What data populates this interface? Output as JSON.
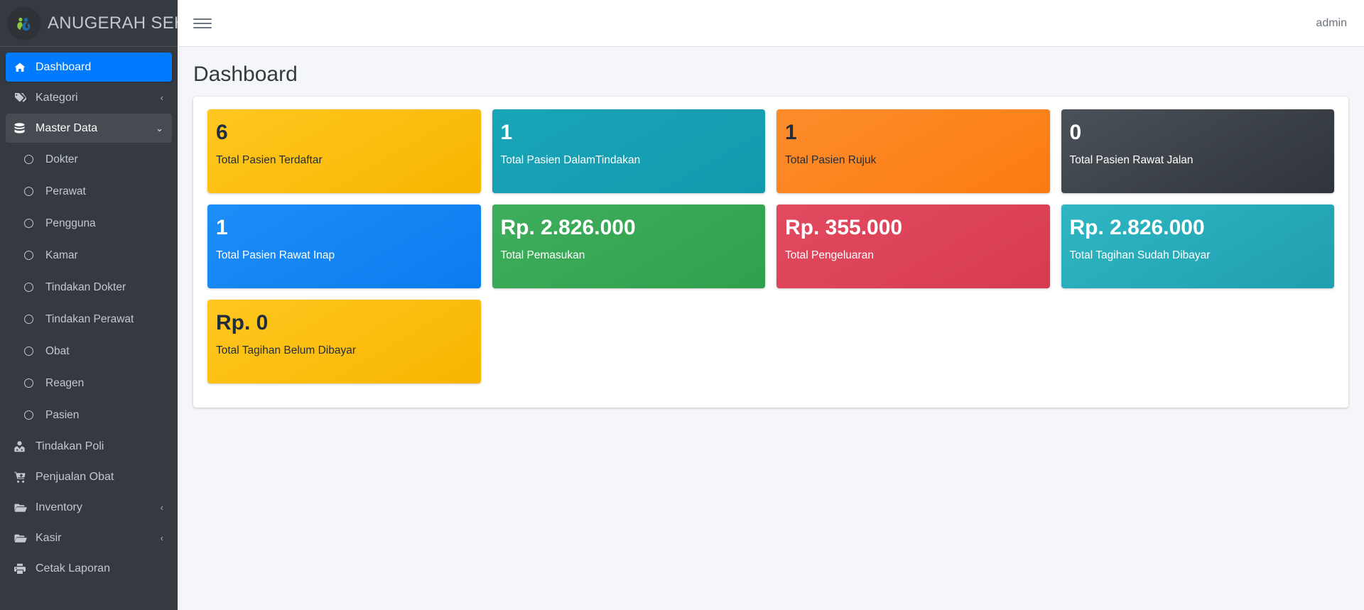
{
  "brand": {
    "title": "ANUGERAH SEHAT",
    "logo_icon": "anugerah-sehat-logo"
  },
  "topbar": {
    "menu_toggle_icon": "hamburger-icon",
    "user_label": "admin"
  },
  "page": {
    "title": "Dashboard"
  },
  "sidebar": {
    "items": [
      {
        "label": "Dashboard",
        "icon": "home-icon",
        "state": "active",
        "arrow": ""
      },
      {
        "label": "Kategori",
        "icon": "tag-icon",
        "state": "collapsed",
        "arrow": "‹"
      },
      {
        "label": "Master Data",
        "icon": "database-icon",
        "state": "open",
        "arrow": "⌄"
      }
    ],
    "master_data_children": [
      {
        "label": "Dokter",
        "icon": "circle-icon"
      },
      {
        "label": "Perawat",
        "icon": "circle-icon"
      },
      {
        "label": "Pengguna",
        "icon": "circle-icon"
      },
      {
        "label": "Kamar",
        "icon": "circle-icon"
      },
      {
        "label": "Tindakan Dokter",
        "icon": "circle-icon"
      },
      {
        "label": "Tindakan Perawat",
        "icon": "circle-icon"
      },
      {
        "label": "Obat",
        "icon": "circle-icon"
      },
      {
        "label": "Reagen",
        "icon": "circle-icon"
      },
      {
        "label": "Pasien",
        "icon": "circle-icon"
      }
    ],
    "items_bottom": [
      {
        "label": "Tindakan Poli",
        "icon": "user-md-icon",
        "state": "normal",
        "arrow": ""
      },
      {
        "label": "Penjualan Obat",
        "icon": "cart-plus-icon",
        "state": "normal",
        "arrow": ""
      },
      {
        "label": "Inventory",
        "icon": "folder-open-icon",
        "state": "collapsed",
        "arrow": "‹"
      },
      {
        "label": "Kasir",
        "icon": "folder-open-icon",
        "state": "collapsed",
        "arrow": "‹"
      },
      {
        "label": "Cetak Laporan",
        "icon": "print-icon",
        "state": "normal",
        "arrow": ""
      }
    ]
  },
  "colors": {
    "accent_blue": "#007bff",
    "sidebar_bg": "#343a40",
    "content_bg": "#f4f6f9",
    "warning": "#ffc107",
    "info": "#17a2b8",
    "orange": "#fd7e14",
    "dark": "#343a40",
    "primary": "#007bff",
    "success": "#28a745",
    "danger": "#dc3545",
    "teal": "#20a8b8"
  },
  "stats": [
    {
      "value": "6",
      "label": "Total Pasien Terdaftar",
      "color_start": "#ffc720",
      "color_end": "#f8b500",
      "text": "dark"
    },
    {
      "value": "1",
      "label": "Total Pasien DalamTindakan",
      "color_start": "#19a4b8",
      "color_end": "#149aad",
      "text": "light"
    },
    {
      "value": "1",
      "label": "Total Pasien Rujuk",
      "color_start": "#fd8c2b",
      "color_end": "#fb7c11",
      "text": "dark"
    },
    {
      "value": "0",
      "label": "Total Pasien Rawat Jalan",
      "color_start": "#454c54",
      "color_end": "#2f353b",
      "text": "light"
    },
    {
      "value": "1",
      "label": "Total Pasien Rawat Inap",
      "color_start": "#1d8ef8",
      "color_end": "#0b7cf0",
      "text": "light"
    },
    {
      "value": "Rp. 2.826.000",
      "label": "Total Pemasukan",
      "color_start": "#3cab5a",
      "color_end": "#32a04f",
      "text": "light"
    },
    {
      "value": "Rp. 355.000",
      "label": "Total Pengeluaran",
      "color_start": "#e04a5f",
      "color_end": "#d93b52",
      "text": "light"
    },
    {
      "value": "Rp. 2.826.000",
      "label": "Total Tagihan Sudah Dibayar",
      "color_start": "#2bb3c0",
      "color_end": "#1f9fb0",
      "text": "light"
    },
    {
      "value": "Rp. 0",
      "label": "Total Tagihan Belum Dibayar",
      "color_start": "#ffc720",
      "color_end": "#f8b500",
      "text": "dark"
    }
  ]
}
